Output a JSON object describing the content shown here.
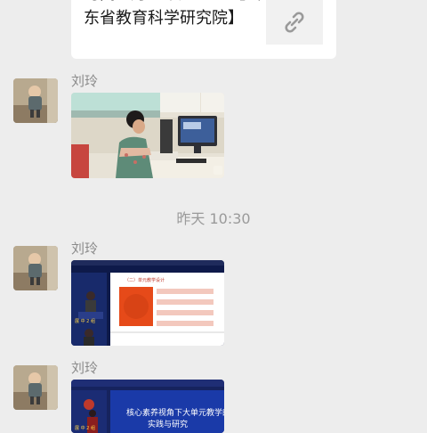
{
  "link_card": {
    "title": "时间 7月18日08:30【山\n东省教育科学研究院】",
    "icon": "link-icon"
  },
  "messages": [
    {
      "sender": "刘玲",
      "type": "image",
      "content": "photo"
    },
    {
      "sender": "刘玲",
      "type": "image",
      "content": "screenshot"
    },
    {
      "sender": "刘玲",
      "type": "image",
      "content": "screenshot"
    }
  ],
  "timestamp": "昨天 10:30",
  "screens": {
    "slide1_section": "（二）单元教学设计",
    "slide1_name": "展 中 2 组",
    "slide2_title_line1": "核心素养视角下大单元教学的",
    "slide2_title_line2": "实践与研究",
    "slide2_name": "展 中 2 组"
  },
  "colors": {
    "background": "#ededed",
    "card": "#ffffff",
    "sender_text": "#8a8a8a",
    "slide_blue": "#16235e"
  }
}
